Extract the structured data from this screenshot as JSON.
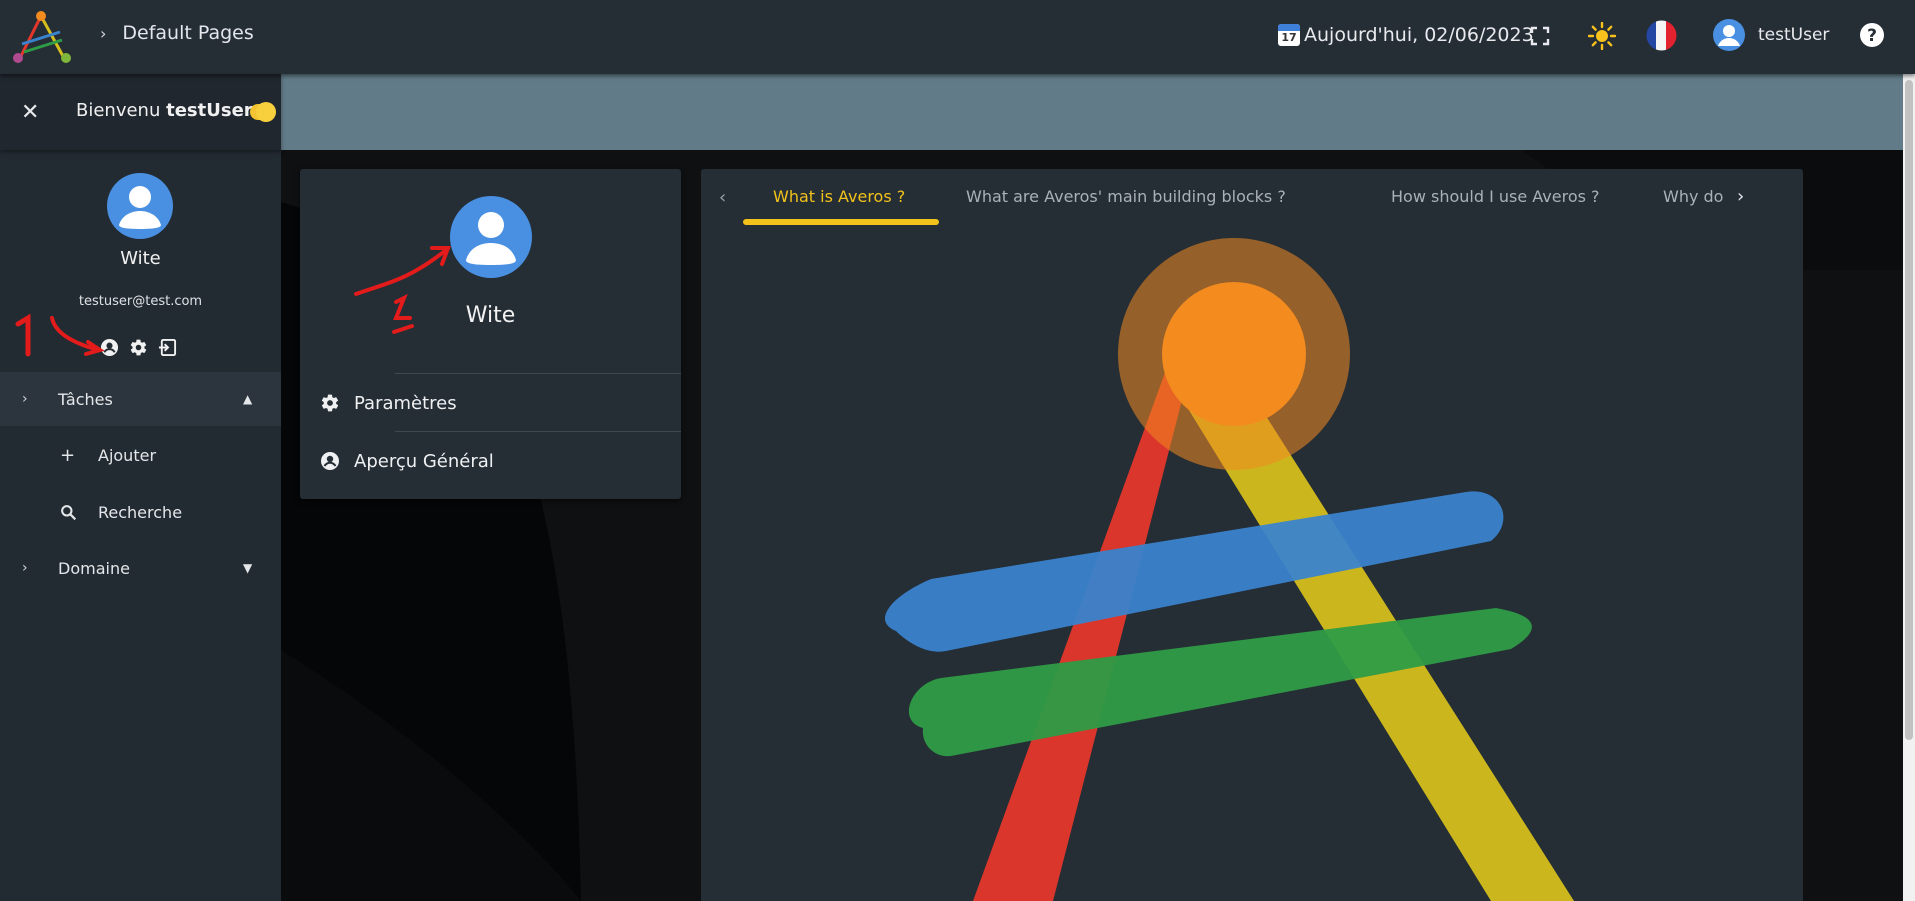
{
  "topbar": {
    "breadcrumb": "Default Pages",
    "date_label": "Aujourd'hui, 02/06/2023",
    "calendar_day": "17",
    "username": "testUser"
  },
  "sidebar": {
    "welcome_prefix": "Bienvenu ",
    "welcome_user": "testUser",
    "welcome_suffix": " !",
    "profile_name": "Wite",
    "profile_email": "testuser@test.com",
    "nav": [
      {
        "label": "Tâches",
        "expanded": true
      },
      {
        "label": "Domaine",
        "expanded": false
      }
    ],
    "sub_items": [
      {
        "label": "Ajouter",
        "icon": "plus-icon"
      },
      {
        "label": "Recherche",
        "icon": "search-icon"
      }
    ]
  },
  "profile_card": {
    "name": "Wite",
    "items": [
      {
        "label": "Paramètres",
        "icon": "gear-icon"
      },
      {
        "label": "Aperçu Général",
        "icon": "account-circle-icon"
      }
    ]
  },
  "content": {
    "tabs": [
      {
        "label": "What is Averos ?",
        "active": true
      },
      {
        "label": "What are Averos' main building blocks ?",
        "active": false
      },
      {
        "label": "How should I use Averos ?",
        "active": false
      },
      {
        "label": "Why do I need Averos ?",
        "active": false
      }
    ]
  },
  "annotations": {
    "marker_1": "1",
    "marker_2": "2"
  },
  "colors": {
    "accent": "#f2c21b",
    "avatar": "#4a90e2",
    "topbar": "#252d35",
    "banner": "#627b88",
    "logo_orange": "#f38b1f",
    "logo_red": "#e4372b",
    "logo_blue": "#3a83cc",
    "logo_green": "#2e9c46",
    "logo_yellow": "#d4bf1c"
  }
}
